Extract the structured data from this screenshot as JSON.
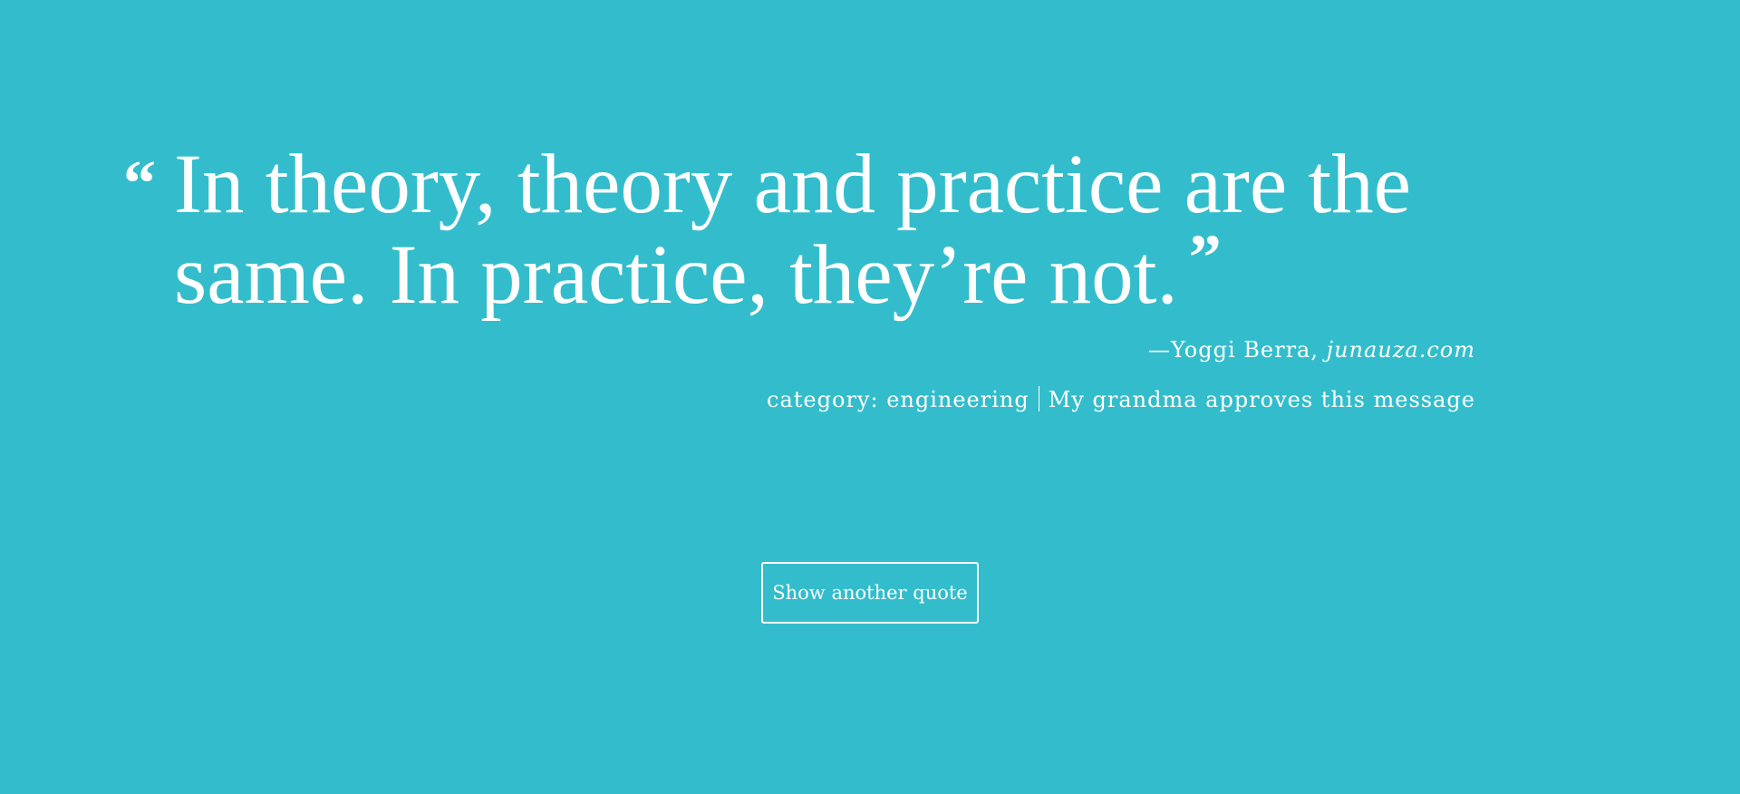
{
  "quote": {
    "open_mark": "“",
    "text": "In theory, theory and practice are the same. In practice, they’re not.",
    "close_mark": "”"
  },
  "attribution": {
    "prefix": "—Yoggi Berra,",
    "source": "junauza.com"
  },
  "meta": {
    "category": "category: engineering",
    "note": "My grandma approves this message"
  },
  "button": {
    "label": "Show another quote"
  },
  "colors": {
    "background": "#33bdcc",
    "text": "#ffffff"
  }
}
